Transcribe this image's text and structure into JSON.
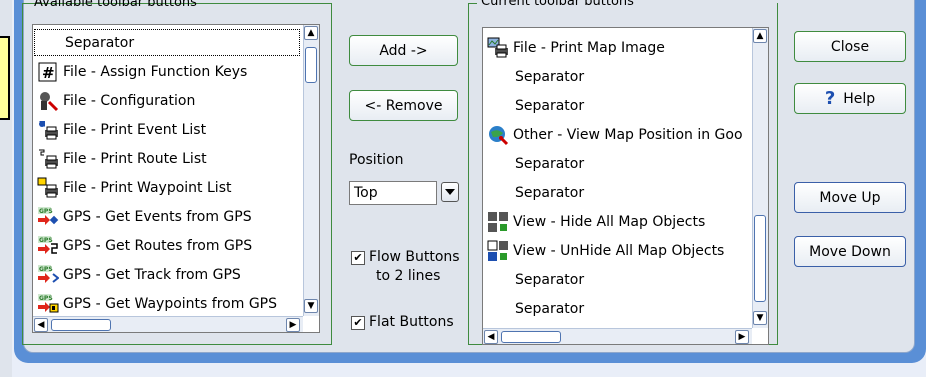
{
  "available": {
    "title": "Available toolbar buttons",
    "items": [
      {
        "label": "Separator",
        "icon": "none"
      },
      {
        "label": "File - Assign Function Keys",
        "icon": "hash-key-icon"
      },
      {
        "label": "File - Configuration",
        "icon": "configuration-icon"
      },
      {
        "label": "File - Print Event List",
        "icon": "print-event-icon"
      },
      {
        "label": "File - Print Route List",
        "icon": "print-route-icon"
      },
      {
        "label": "File - Print Waypoint List",
        "icon": "print-waypoint-icon"
      },
      {
        "label": "GPS - Get Events from GPS",
        "icon": "gps-events-icon"
      },
      {
        "label": "GPS - Get Routes from GPS",
        "icon": "gps-routes-icon"
      },
      {
        "label": "GPS - Get Track from GPS",
        "icon": "gps-track-icon"
      },
      {
        "label": "GPS - Get Waypoints from GPS",
        "icon": "gps-waypoints-icon"
      }
    ]
  },
  "current": {
    "title": "Current toolbar buttons",
    "items": [
      {
        "label": "File - Print Map Image",
        "icon": "print-map-icon"
      },
      {
        "label": "Separator",
        "icon": "none"
      },
      {
        "label": "Separator",
        "icon": "none"
      },
      {
        "label": "Other - View Map Position in Goo",
        "icon": "globe-icon"
      },
      {
        "label": "Separator",
        "icon": "none"
      },
      {
        "label": "Separator",
        "icon": "none"
      },
      {
        "label": "View - Hide All Map Objects",
        "icon": "hide-objects-icon"
      },
      {
        "label": "View - UnHide All Map Objects",
        "icon": "unhide-objects-icon"
      },
      {
        "label": "Separator",
        "icon": "none"
      },
      {
        "label": "Separator",
        "icon": "none"
      }
    ]
  },
  "buttons": {
    "add": "Add ->",
    "remove": "<- Remove",
    "close": "Close",
    "help": "Help",
    "move_up": "Move Up",
    "move_down": "Move Down"
  },
  "position": {
    "label": "Position",
    "value": "Top"
  },
  "options": {
    "flow_line1": "Flow Buttons",
    "flow_line2": "to 2 lines",
    "flow_checked": true,
    "flat": "Flat Buttons",
    "flat_checked": true
  },
  "colors": {
    "frame": "#5a8fd6",
    "group_border": "#3f8b3f",
    "help_icon": "#1d4fb0"
  }
}
